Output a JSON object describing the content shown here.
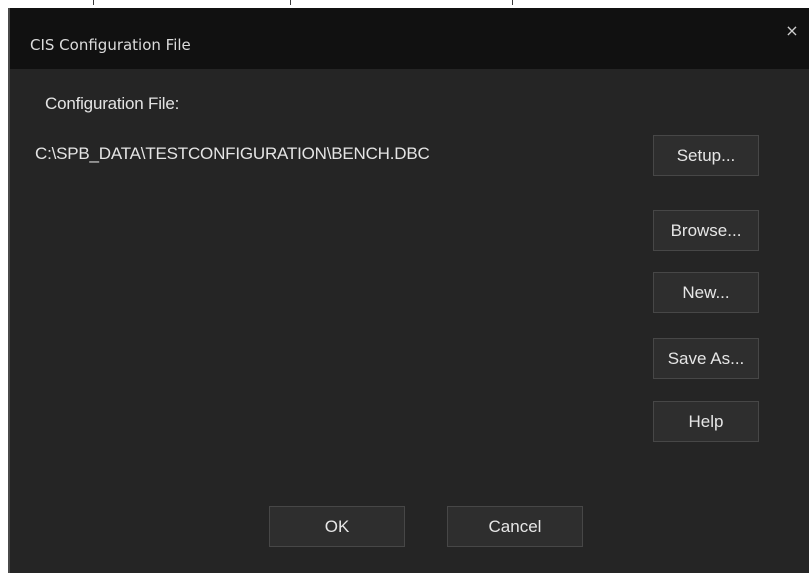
{
  "window": {
    "title": "CIS Configuration File",
    "close_glyph": "×"
  },
  "main": {
    "config_label": "Configuration File:",
    "config_path": "C:\\SPB_DATA\\TESTCONFIGURATION\\BENCH.DBC"
  },
  "buttons": {
    "setup": "Setup...",
    "browse": "Browse...",
    "new": "New...",
    "save_as": "Save As...",
    "help": "Help"
  },
  "footer": {
    "ok": "OK",
    "cancel": "Cancel"
  },
  "colors": {
    "background": "#252525",
    "titlebar": "#111111",
    "button_face": "#2e2e2e",
    "text": "#e4e4e4"
  }
}
